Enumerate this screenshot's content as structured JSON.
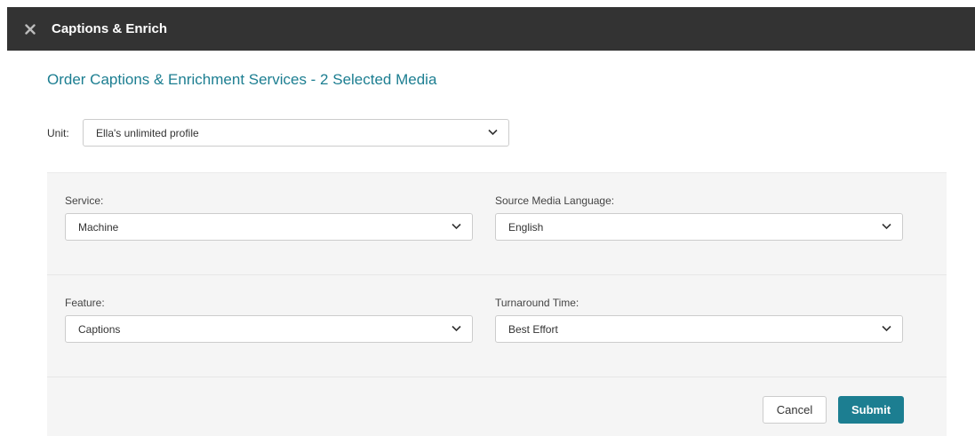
{
  "header": {
    "title": "Captions & Enrich"
  },
  "page": {
    "title": "Order Captions & Enrichment Services - 2 Selected Media"
  },
  "unit": {
    "label": "Unit:",
    "value": "Ella's unlimited profile"
  },
  "form": {
    "service": {
      "label": "Service:",
      "value": "Machine"
    },
    "source_language": {
      "label": "Source Media Language:",
      "value": "English"
    },
    "feature": {
      "label": "Feature:",
      "value": "Captions"
    },
    "turnaround": {
      "label": "Turnaround Time:",
      "value": "Best Effort"
    }
  },
  "actions": {
    "cancel_label": "Cancel",
    "submit_label": "Submit"
  },
  "colors": {
    "accent": "#1c7e91",
    "header_bg": "#333333",
    "panel_bg": "#f5f5f5"
  },
  "icons": {
    "close": "close-icon",
    "dropdown": "chevron-down-icon"
  }
}
